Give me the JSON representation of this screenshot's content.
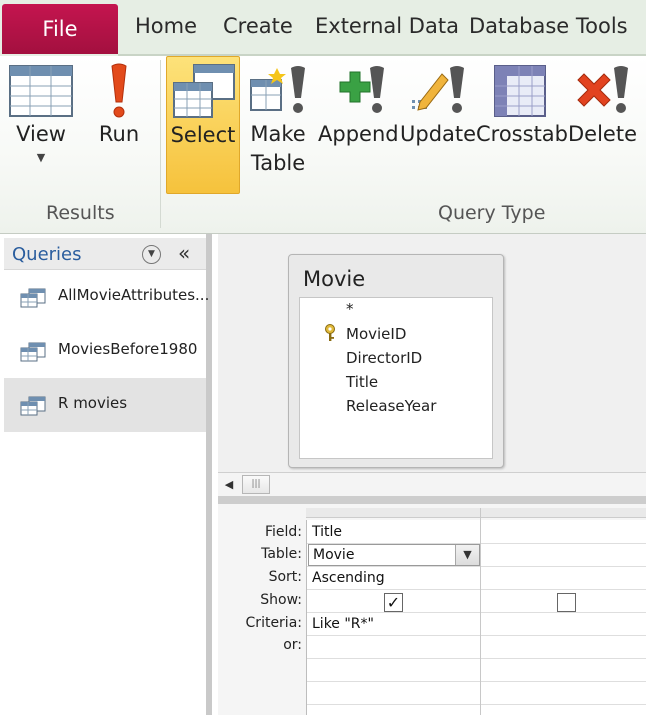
{
  "ribbon": {
    "file_tab": "File",
    "tabs": [
      "Home",
      "Create",
      "External Data",
      "Database Tools"
    ],
    "buttons": {
      "view": "View",
      "run": "Run",
      "select": "Select",
      "make_table_line1": "Make",
      "make_table_line2": "Table",
      "append": "Append",
      "update": "Update",
      "crosstab": "Crosstab",
      "delete": "Delete"
    },
    "groups": {
      "results": "Results",
      "query_type": "Query Type"
    }
  },
  "nav": {
    "title": "Queries",
    "collapse_symbol": "«",
    "items": [
      {
        "label": "AllMovieAttributes..."
      },
      {
        "label": "MoviesBefore1980"
      },
      {
        "label": "R movies",
        "selected": true
      }
    ]
  },
  "table_box": {
    "title": "Movie",
    "fields": [
      "*",
      "MovieID",
      "DirectorID",
      "Title",
      "ReleaseYear"
    ],
    "primary_key": "MovieID"
  },
  "qbe": {
    "row_labels": {
      "field": "Field:",
      "table": "Table:",
      "sort": "Sort:",
      "show": "Show:",
      "criteria": "Criteria:",
      "or": "or:"
    },
    "columns": [
      {
        "field": "Title",
        "table": "Movie",
        "sort": "Ascending",
        "show": true,
        "criteria": "Like \"R*\""
      },
      {
        "field": "",
        "table": "",
        "sort": "",
        "show": false,
        "criteria": ""
      }
    ]
  },
  "colors": {
    "file_tab": "#b5134a",
    "select_highlight": "#f8cc4a",
    "nav_title": "#2a5d9e"
  }
}
